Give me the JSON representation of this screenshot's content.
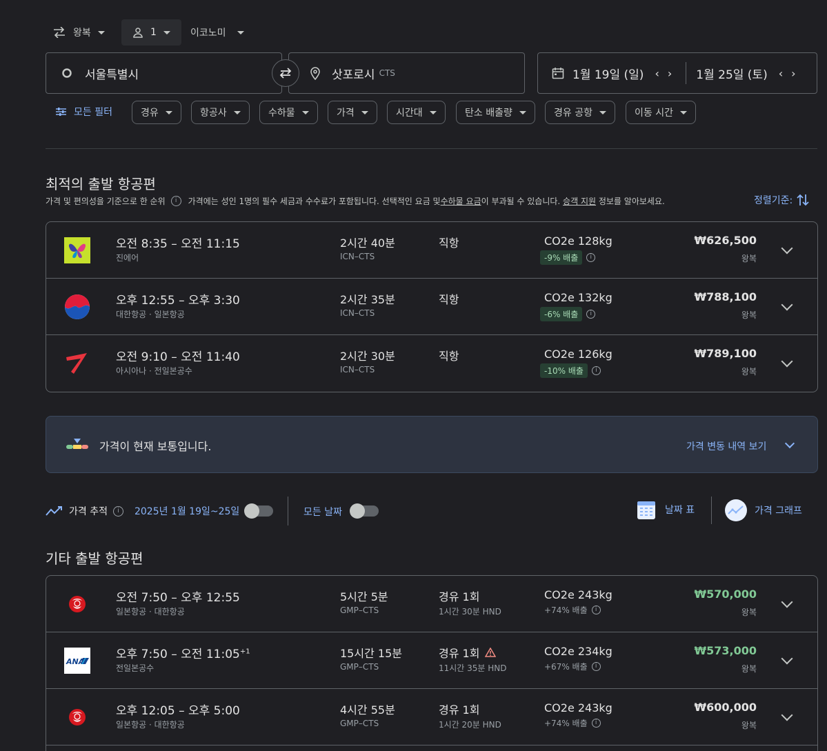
{
  "top": {
    "trip_type": "왕복",
    "passengers": "1",
    "cabin_class": "이코노미"
  },
  "search": {
    "origin": "서울특별시",
    "destination": "삿포로시",
    "destination_code": "CTS",
    "depart_date": "1월 19일 (일)",
    "return_date": "1월 25일 (토)"
  },
  "filters": {
    "all_filters": "모든 필터",
    "chips": [
      "경유",
      "항공사",
      "수하물",
      "가격",
      "시간대",
      "탄소 배출량",
      "경유 공항",
      "이동 시간"
    ]
  },
  "best": {
    "title": "최적의 출발 항공편",
    "subtitle_prefix": "가격 및 편의성을 기준으로 한 순위",
    "subtitle_main_1": "가격에는 성인 1명의 필수 세금과 수수료가 포함됩니다. 선택적인 요금 및 ",
    "subtitle_link_1": "수하물 요금",
    "subtitle_main_2": "이 부과될 수 있습니다. ",
    "subtitle_link_2": "승객 지원",
    "subtitle_main_3": " 정보를 알아보세요.",
    "sort_label": "정렬기준:",
    "flights": [
      {
        "logo": "jinair-logo",
        "times": "오전 8:35 – 오전 11:15",
        "airline": "진에어",
        "duration": "2시간 40분",
        "route": "ICN–CTS",
        "stops": "직항",
        "co2": "CO2e 128kg",
        "emissions": "-9% 배출",
        "price": "₩626,500",
        "price_type": "왕복"
      },
      {
        "logo": "koreanair-logo",
        "times": "오후 12:55 – 오후 3:30",
        "airline": "대한항공 · 일본항공",
        "duration": "2시간 35분",
        "route": "ICN–CTS",
        "stops": "직항",
        "co2": "CO2e 132kg",
        "emissions": "-6% 배출",
        "price": "₩788,100",
        "price_type": "왕복"
      },
      {
        "logo": "asiana-logo",
        "times": "오전 9:10 – 오전 11:40",
        "airline": "아시아나 · 전일본공수",
        "duration": "2시간 30분",
        "route": "ICN–CTS",
        "stops": "직항",
        "co2": "CO2e 126kg",
        "emissions": "-10% 배출",
        "price": "₩789,100",
        "price_type": "왕복"
      }
    ]
  },
  "insight": {
    "text": "가격이 현재 보통입니다.",
    "link": "가격 변동 내역 보기"
  },
  "tracking": {
    "label": "가격 추적",
    "dates": "2025년 1월 19일~25일",
    "any_dates": "모든 날짜",
    "date_grid": "날짜 표",
    "price_graph": "가격 그래프"
  },
  "other": {
    "title": "기타 출발 항공편",
    "flights": [
      {
        "logo": "jal-logo",
        "times": "오전 7:50 – 오후 12:55",
        "sup": "",
        "airline": "일본항공 · 대한항공",
        "duration": "5시간 5분",
        "route": "GMP–CTS",
        "stops": "경유 1회",
        "layover": "1시간 30분 HND",
        "co2": "CO2e 243kg",
        "emissions": "+74% 배출",
        "price": "₩570,000",
        "price_type": "왕복",
        "price_color": "#81c995"
      },
      {
        "logo": "ana-logo",
        "times": "오후 7:50 – 오전 11:05",
        "sup": "+1",
        "airline": "전일본공수",
        "duration": "15시간 15분",
        "route": "GMP–CTS",
        "stops": "경유 1회",
        "layover": "11시간 35분 HND",
        "co2": "CO2e 234kg",
        "emissions": "+67% 배출",
        "price": "₩573,000",
        "price_type": "왕복",
        "price_color": "#81c995"
      },
      {
        "logo": "jal-logo",
        "times": "오후 12:05 – 오후 5:00",
        "sup": "",
        "airline": "일본항공 · 대한항공",
        "duration": "4시간 55분",
        "route": "GMP–CTS",
        "stops": "경유 1회",
        "layover": "1시간 20분 HND",
        "co2": "CO2e 243kg",
        "emissions": "+74% 배출",
        "price": "₩600,000",
        "price_type": "왕복",
        "price_color": "#e3e3e3"
      }
    ]
  }
}
